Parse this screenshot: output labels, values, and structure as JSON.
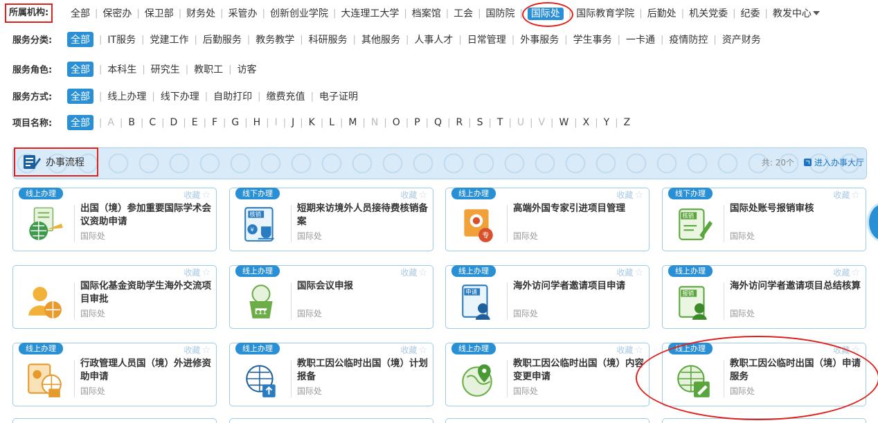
{
  "filters": {
    "org": {
      "label": "所属机构:",
      "items": [
        "全部",
        "保密办",
        "保卫部",
        "财务处",
        "采管办",
        "创新创业学院",
        "大连理工大学",
        "档案馆",
        "工会",
        "国防院",
        "国际处",
        "国际教育学院",
        "后勤处",
        "机关党委",
        "纪委",
        "教发中心"
      ],
      "selected": "国际处"
    },
    "category": {
      "label": "服务分类:",
      "items": [
        "全部",
        "IT服务",
        "党建工作",
        "后勤服务",
        "教务教学",
        "科研服务",
        "其他服务",
        "人事人才",
        "日常管理",
        "外事服务",
        "学生事务",
        "一卡通",
        "疫情防控",
        "资产财务"
      ],
      "selected": "全部"
    },
    "role": {
      "label": "服务角色:",
      "items": [
        "全部",
        "本科生",
        "研究生",
        "教职工",
        "访客"
      ],
      "selected": "全部"
    },
    "method": {
      "label": "服务方式:",
      "items": [
        "全部",
        "线上办理",
        "线下办理",
        "自助打印",
        "缴费充值",
        "电子证明"
      ],
      "selected": "全部"
    },
    "name": {
      "label": "项目名称:",
      "items": [
        "全部",
        "A",
        "B",
        "C",
        "D",
        "E",
        "F",
        "G",
        "H",
        "I",
        "J",
        "K",
        "L",
        "M",
        "N",
        "O",
        "P",
        "Q",
        "R",
        "S",
        "T",
        "U",
        "V",
        "W",
        "X",
        "Y",
        "Z"
      ],
      "disabled": [
        "A",
        "I",
        "N",
        "U",
        "V"
      ],
      "selected": "全部"
    }
  },
  "banner": {
    "title": "办事流程",
    "count": "共: 20个",
    "enter": "进入办事大厅"
  },
  "fav_label": "收藏",
  "cards": [
    {
      "badge": "线上办理",
      "title": "出国（境）参加重要国际学术会议资助申请",
      "dept": "国际处",
      "icon": "meeting-globe-icon"
    },
    {
      "badge": "线下办理",
      "title": "短期来访境外人员接待费核销备案",
      "dept": "国际处",
      "icon": "reimbursement-coffee-icon"
    },
    {
      "badge": "线上办理",
      "title": "高端外国专家引进项目管理",
      "dept": "国际处",
      "icon": "expert-certificate-icon"
    },
    {
      "badge": "线下办理",
      "title": "国际处账号报销审核",
      "dept": "国际处",
      "icon": "reimbursement-pen-icon"
    },
    {
      "badge": "",
      "title": "国际化基金资助学生海外交流项目审批",
      "dept": "国际处",
      "icon": "student-globe-icon"
    },
    {
      "badge": "线上办理",
      "title": "国际会议申报",
      "dept": "国际处",
      "icon": "podium-icon"
    },
    {
      "badge": "线上办理",
      "title": "海外访问学者邀请项目申请",
      "dept": "国际处",
      "icon": "apply-scholar-icon"
    },
    {
      "badge": "线上办理",
      "title": "海外访问学者邀请项目总结核算",
      "dept": "国际处",
      "icon": "report-scholar-icon"
    },
    {
      "badge": "线上办理",
      "title": "行政管理人员国（境）外进修资助申请",
      "dept": "国际处",
      "icon": "funding-globe-icon"
    },
    {
      "badge": "线上办理",
      "title": "教职工因公临时出国（境）计划报备",
      "dept": "国际处",
      "icon": "globe-upload-icon"
    },
    {
      "badge": "线上办理",
      "title": "教职工因公临时出国（境）内容变更申请",
      "dept": "国际处",
      "icon": "map-pin-globe-icon"
    },
    {
      "badge": "线上办理",
      "title": "教职工因公临时出国（境）申请服务",
      "dept": "国际处",
      "icon": "globe-edit-icon"
    }
  ],
  "colors": {
    "accent": "#2a90d6",
    "highlight": "#e0201a",
    "badge": "#2a90d6"
  }
}
